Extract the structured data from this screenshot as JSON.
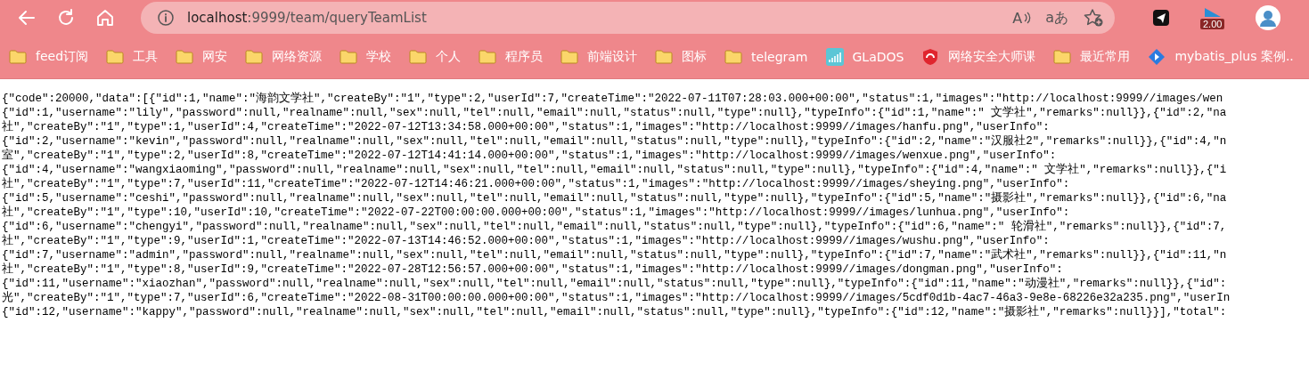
{
  "browser": {
    "url_host": "localhost",
    "url_rest": ":9999/team/queryTeamList",
    "read_glyph": "A",
    "translate_glyph": "aあ",
    "extension_badge": "2.00"
  },
  "bookmarks": [
    {
      "label": "feed订阅",
      "kind": "folder"
    },
    {
      "label": "工具",
      "kind": "folder"
    },
    {
      "label": "网安",
      "kind": "folder"
    },
    {
      "label": "网络资源",
      "kind": "folder"
    },
    {
      "label": "学校",
      "kind": "folder"
    },
    {
      "label": "个人",
      "kind": "folder"
    },
    {
      "label": "程序员",
      "kind": "folder"
    },
    {
      "label": "前端设计",
      "kind": "folder"
    },
    {
      "label": "图标",
      "kind": "folder"
    },
    {
      "label": "telegram",
      "kind": "folder"
    },
    {
      "label": "GLaDOS",
      "kind": "bars"
    },
    {
      "label": "网络安全大师课",
      "kind": "shield"
    },
    {
      "label": "最近常用",
      "kind": "folder"
    },
    {
      "label": "mybatis_plus 案例..",
      "kind": "diamond"
    }
  ],
  "page_lines": [
    "{\"code\":20000,\"data\":[{\"id\":1,\"name\":\"海韵文学社\",\"createBy\":\"1\",\"type\":2,\"userId\":7,\"createTime\":\"2022-07-11T07:28:03.000+00:00\",\"status\":1,\"images\":\"http://localhost:9999//images/wen",
    "{\"id\":1,\"username\":\"lily\",\"password\":null,\"realname\":null,\"sex\":null,\"tel\":null,\"email\":null,\"status\":null,\"type\":null},\"typeInfo\":{\"id\":1,\"name\":\" 文学社\",\"remarks\":null}},{\"id\":2,\"na",
    "社\",\"createBy\":\"1\",\"type\":1,\"userId\":4,\"createTime\":\"2022-07-12T13:34:58.000+00:00\",\"status\":1,\"images\":\"http://localhost:9999//images/hanfu.png\",\"userInfo\":",
    "{\"id\":2,\"username\":\"kevin\",\"password\":null,\"realname\":null,\"sex\":null,\"tel\":null,\"email\":null,\"status\":null,\"type\":null},\"typeInfo\":{\"id\":2,\"name\":\"汉服社2\",\"remarks\":null}},{\"id\":4,\"n",
    "室\",\"createBy\":\"1\",\"type\":2,\"userId\":8,\"createTime\":\"2022-07-12T14:41:14.000+00:00\",\"status\":1,\"images\":\"http://localhost:9999//images/wenxue.png\",\"userInfo\":",
    "{\"id\":4,\"username\":\"wangxiaoming\",\"password\":null,\"realname\":null,\"sex\":null,\"tel\":null,\"email\":null,\"status\":null,\"type\":null},\"typeInfo\":{\"id\":4,\"name\":\" 文学社\",\"remarks\":null}},{\"i",
    "社\",\"createBy\":\"1\",\"type\":7,\"userId\":11,\"createTime\":\"2022-07-12T14:46:21.000+00:00\",\"status\":1,\"images\":\"http://localhost:9999//images/sheying.png\",\"userInfo\":",
    "{\"id\":5,\"username\":\"ceshi\",\"password\":null,\"realname\":null,\"sex\":null,\"tel\":null,\"email\":null,\"status\":null,\"type\":null},\"typeInfo\":{\"id\":5,\"name\":\"摄影社\",\"remarks\":null}},{\"id\":6,\"na",
    "社\",\"createBy\":\"1\",\"type\":10,\"userId\":10,\"createTime\":\"2022-07-22T00:00:00.000+00:00\",\"status\":1,\"images\":\"http://localhost:9999//images/lunhua.png\",\"userInfo\":",
    "{\"id\":6,\"username\":\"chengyi\",\"password\":null,\"realname\":null,\"sex\":null,\"tel\":null,\"email\":null,\"status\":null,\"type\":null},\"typeInfo\":{\"id\":6,\"name\":\" 轮滑社\",\"remarks\":null}},{\"id\":7,",
    "社\",\"createBy\":\"1\",\"type\":9,\"userId\":1,\"createTime\":\"2022-07-13T14:46:52.000+00:00\",\"status\":1,\"images\":\"http://localhost:9999//images/wushu.png\",\"userInfo\":",
    "{\"id\":7,\"username\":\"admin\",\"password\":null,\"realname\":null,\"sex\":null,\"tel\":null,\"email\":null,\"status\":null,\"type\":null},\"typeInfo\":{\"id\":7,\"name\":\"武术社\",\"remarks\":null}},{\"id\":11,\"n",
    "社\",\"createBy\":\"1\",\"type\":8,\"userId\":9,\"createTime\":\"2022-07-28T12:56:57.000+00:00\",\"status\":1,\"images\":\"http://localhost:9999//images/dongman.png\",\"userInfo\":",
    "{\"id\":11,\"username\":\"xiaozhan\",\"password\":null,\"realname\":null,\"sex\":null,\"tel\":null,\"email\":null,\"status\":null,\"type\":null},\"typeInfo\":{\"id\":11,\"name\":\"动漫社\",\"remarks\":null}},{\"id\":",
    "光\",\"createBy\":\"1\",\"type\":7,\"userId\":6,\"createTime\":\"2022-08-31T00:00:00.000+00:00\",\"status\":1,\"images\":\"http://localhost:9999//images/5cdf0d1b-4ac7-46a3-9e8e-68226e32a235.png\",\"userIn",
    "{\"id\":12,\"username\":\"kappy\",\"password\":null,\"realname\":null,\"sex\":null,\"tel\":null,\"email\":null,\"status\":null,\"type\":null},\"typeInfo\":{\"id\":12,\"name\":\"摄影社\",\"remarks\":null}}],\"total\":"
  ]
}
